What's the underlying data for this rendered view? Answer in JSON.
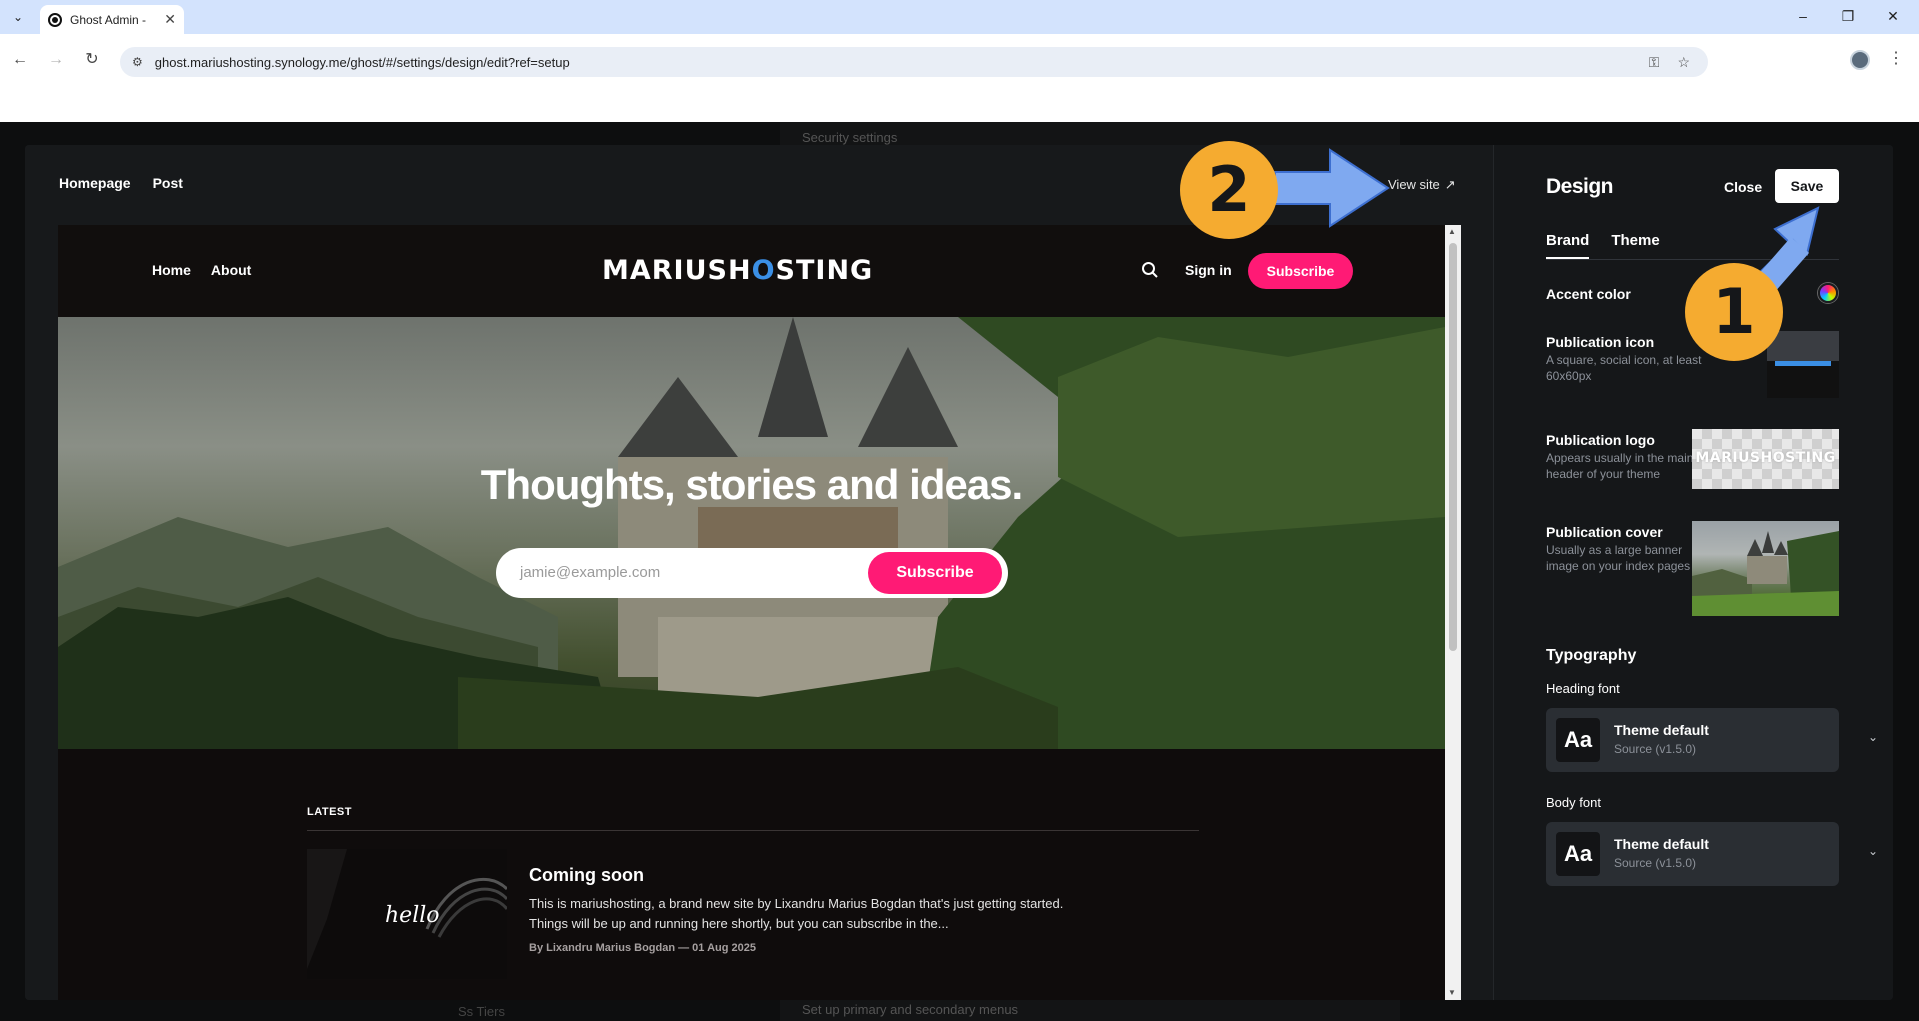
{
  "browser": {
    "tab_title": "Ghost Admin - ",
    "url": "ghost.mariushosting.synology.me/ghost/#/settings/design/edit?ref=setup"
  },
  "background": {
    "top_text": "Security settings",
    "bottom_text": "Set up primary and secondary menus",
    "bottom_left_text": "Ss Tiers"
  },
  "preview": {
    "tabs": [
      "Homepage",
      "Post"
    ],
    "view_site": "View site",
    "site": {
      "nav": [
        "Home",
        "About"
      ],
      "logo_pre": "MARIUSH",
      "logo_o": "O",
      "logo_post": "STING",
      "sign_in": "Sign in",
      "subscribe": "Subscribe",
      "hero_title": "Thoughts, stories and ideas.",
      "email_placeholder": "jamie@example.com",
      "hero_subscribe": "Subscribe",
      "latest_label": "LATEST",
      "post": {
        "image_text": "hello",
        "title": "Coming soon",
        "excerpt": "This is mariushosting, a brand new site by Lixandru Marius Bogdan that's just getting started. Things will be up and running here shortly, but you can subscribe in the...",
        "meta": "By Lixandru Marius Bogdan — 01 Aug 2025"
      }
    }
  },
  "settings": {
    "title": "Design",
    "close": "Close",
    "save": "Save",
    "tabs": [
      "Brand",
      "Theme"
    ],
    "accent_color_label": "Accent color",
    "publication_icon": {
      "label": "Publication icon",
      "desc": "A square, social icon, at least 60x60px"
    },
    "publication_logo": {
      "label": "Publication logo",
      "desc": "Appears usually in the main header of your theme",
      "preview_text": "MARIUSHOSTING"
    },
    "publication_cover": {
      "label": "Publication cover",
      "desc": "Usually as a large banner image on your index pages"
    },
    "typography": "Typography",
    "heading_font": {
      "label": "Heading font",
      "sample": "Aa",
      "name": "Theme default",
      "version": "Source (v1.5.0)"
    },
    "body_font": {
      "label": "Body font",
      "sample": "Aa",
      "name": "Theme default",
      "version": "Source (v1.5.0)"
    }
  },
  "annotations": [
    "1",
    "2"
  ],
  "colors": {
    "accent": "#ff1a75",
    "annotation_circle": "#f5ab30",
    "annotation_arrow": "#7fa9f0"
  }
}
